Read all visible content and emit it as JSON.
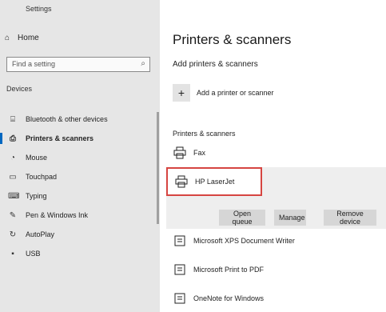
{
  "window": {
    "title": "Settings"
  },
  "sidebar": {
    "home_label": "Home",
    "search_placeholder": "Find a setting",
    "section_label": "Devices",
    "items": [
      {
        "icon": "bluetooth-icon",
        "label": "Bluetooth & other devices"
      },
      {
        "icon": "printer-icon",
        "label": "Printers & scanners",
        "active": true
      },
      {
        "icon": "mouse-icon",
        "label": "Mouse"
      },
      {
        "icon": "touchpad-icon",
        "label": "Touchpad"
      },
      {
        "icon": "typing-icon",
        "label": "Typing"
      },
      {
        "icon": "pen-icon",
        "label": "Pen & Windows Ink"
      },
      {
        "icon": "autoplay-icon",
        "label": "AutoPlay"
      },
      {
        "icon": "usb-icon",
        "label": "USB"
      }
    ]
  },
  "main": {
    "title": "Printers & scanners",
    "add_heading": "Add printers & scanners",
    "add_button_label": "Add a printer or scanner",
    "list_heading": "Printers & scanners",
    "devices": [
      {
        "name": "Fax",
        "icon": "printer-icon"
      },
      {
        "name": "HP LaserJet",
        "icon": "printer-icon",
        "selected": true
      },
      {
        "name": "Microsoft XPS Document Writer",
        "icon": "printer-icon"
      },
      {
        "name": "Microsoft Print to PDF",
        "icon": "printer-icon"
      },
      {
        "name": "OneNote for Windows",
        "icon": "printer-icon"
      }
    ],
    "actions": {
      "open_queue": "Open queue",
      "manage": "Manage",
      "remove": "Remove device"
    }
  },
  "colors": {
    "accent": "#0067c0",
    "selection_outline": "#d64541",
    "sidebar_bg": "#e6e6e6"
  }
}
